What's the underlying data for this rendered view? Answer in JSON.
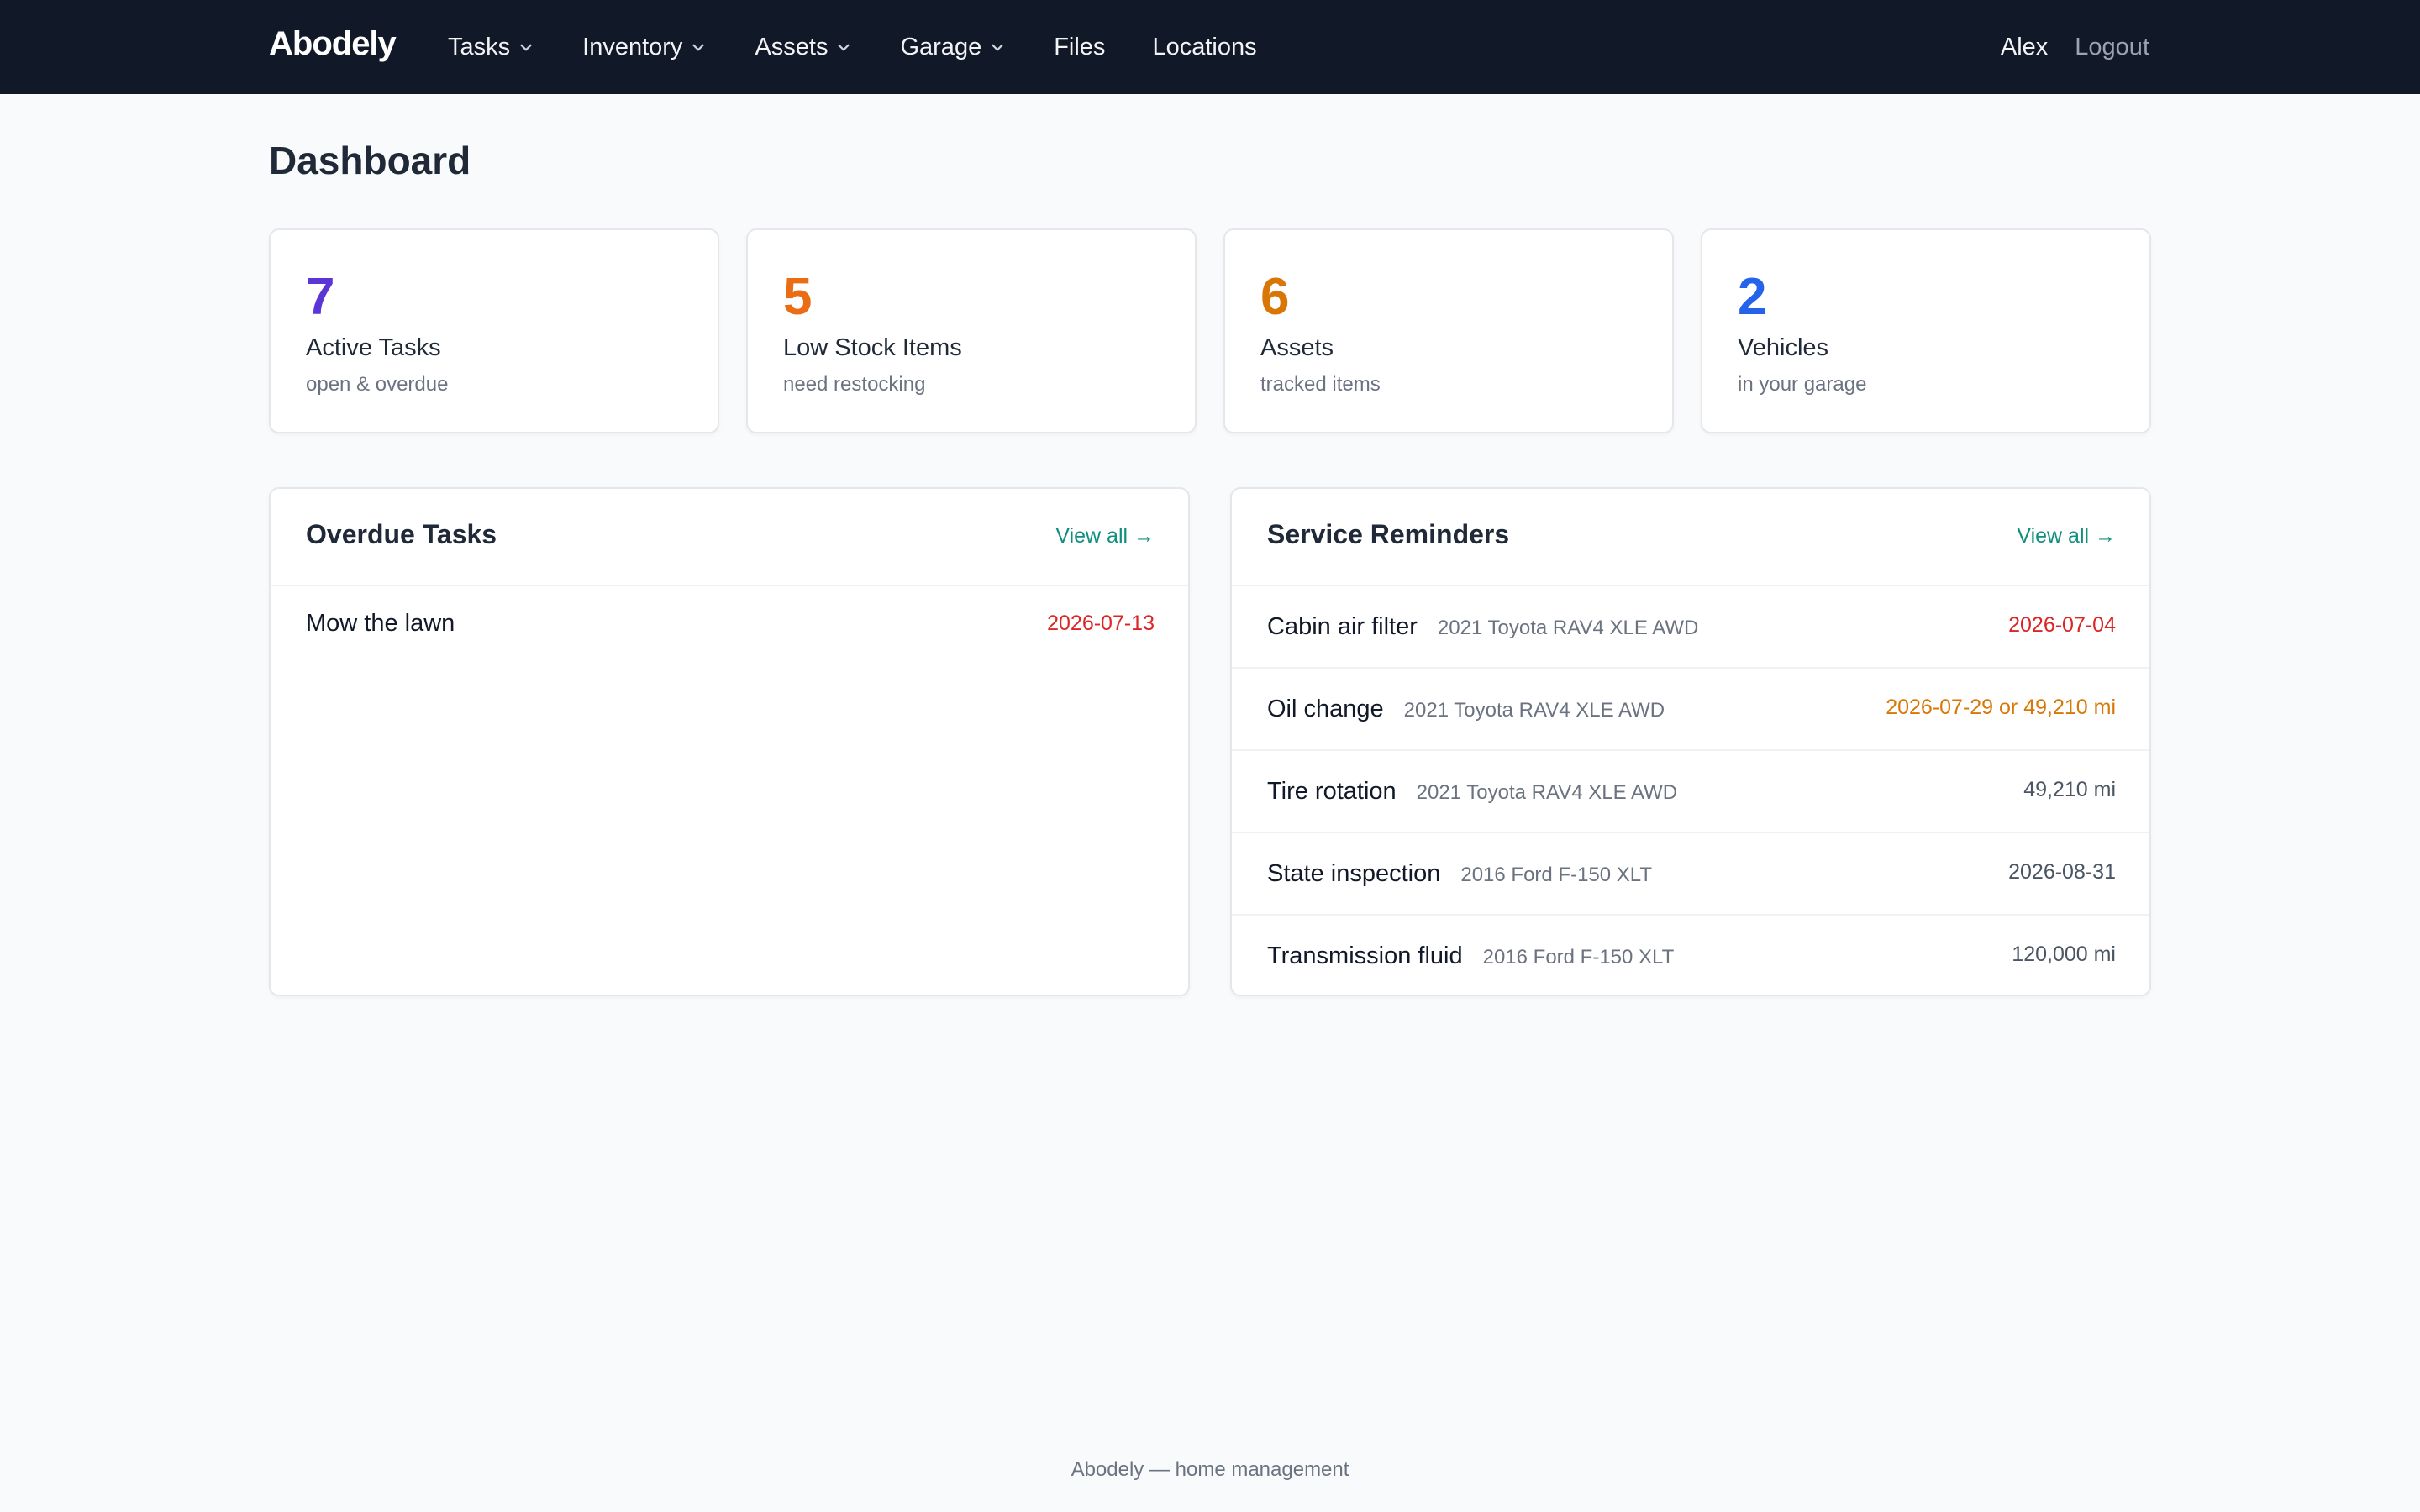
{
  "nav": {
    "brand": "Abodely",
    "items": [
      {
        "label": "Tasks",
        "dropdown": true
      },
      {
        "label": "Inventory",
        "dropdown": true
      },
      {
        "label": "Assets",
        "dropdown": true
      },
      {
        "label": "Garage",
        "dropdown": true
      },
      {
        "label": "Files",
        "dropdown": false
      },
      {
        "label": "Locations",
        "dropdown": false
      }
    ],
    "user": "Alex",
    "logout": "Logout"
  },
  "page": {
    "title": "Dashboard"
  },
  "stats": [
    {
      "value": "7",
      "label": "Active Tasks",
      "sub": "open & overdue",
      "color": "#5b35d5"
    },
    {
      "value": "5",
      "label": "Low Stock Items",
      "sub": "need restocking",
      "color": "#ea6c14"
    },
    {
      "value": "6",
      "label": "Assets",
      "sub": "tracked items",
      "color": "#d97706"
    },
    {
      "value": "2",
      "label": "Vehicles",
      "sub": "in your garage",
      "color": "#2563eb"
    }
  ],
  "overdue": {
    "title": "Overdue Tasks",
    "view_all": "View all →",
    "tasks": [
      {
        "title": "Mow the lawn",
        "date": "2026-07-13"
      }
    ]
  },
  "reminders": {
    "title": "Service Reminders",
    "view_all": "View all →",
    "items": [
      {
        "name": "Cabin air filter",
        "vehicle": "2021 Toyota RAV4 XLE AWD",
        "due": "2026-07-04",
        "color": "#dc2626"
      },
      {
        "name": "Oil change",
        "vehicle": "2021 Toyota RAV4 XLE AWD",
        "due": "2026-07-29 or 49,210 mi",
        "color": "#d97706"
      },
      {
        "name": "Tire rotation",
        "vehicle": "2021 Toyota RAV4 XLE AWD",
        "due": "49,210 mi",
        "color": "#4b5563"
      },
      {
        "name": "State inspection",
        "vehicle": "2016 Ford F-150 XLT",
        "due": "2026-08-31",
        "color": "#4b5563"
      },
      {
        "name": "Transmission fluid",
        "vehicle": "2016 Ford F-150 XLT",
        "due": "120,000 mi",
        "color": "#4b5563"
      }
    ]
  },
  "footer": "Abodely — home management"
}
